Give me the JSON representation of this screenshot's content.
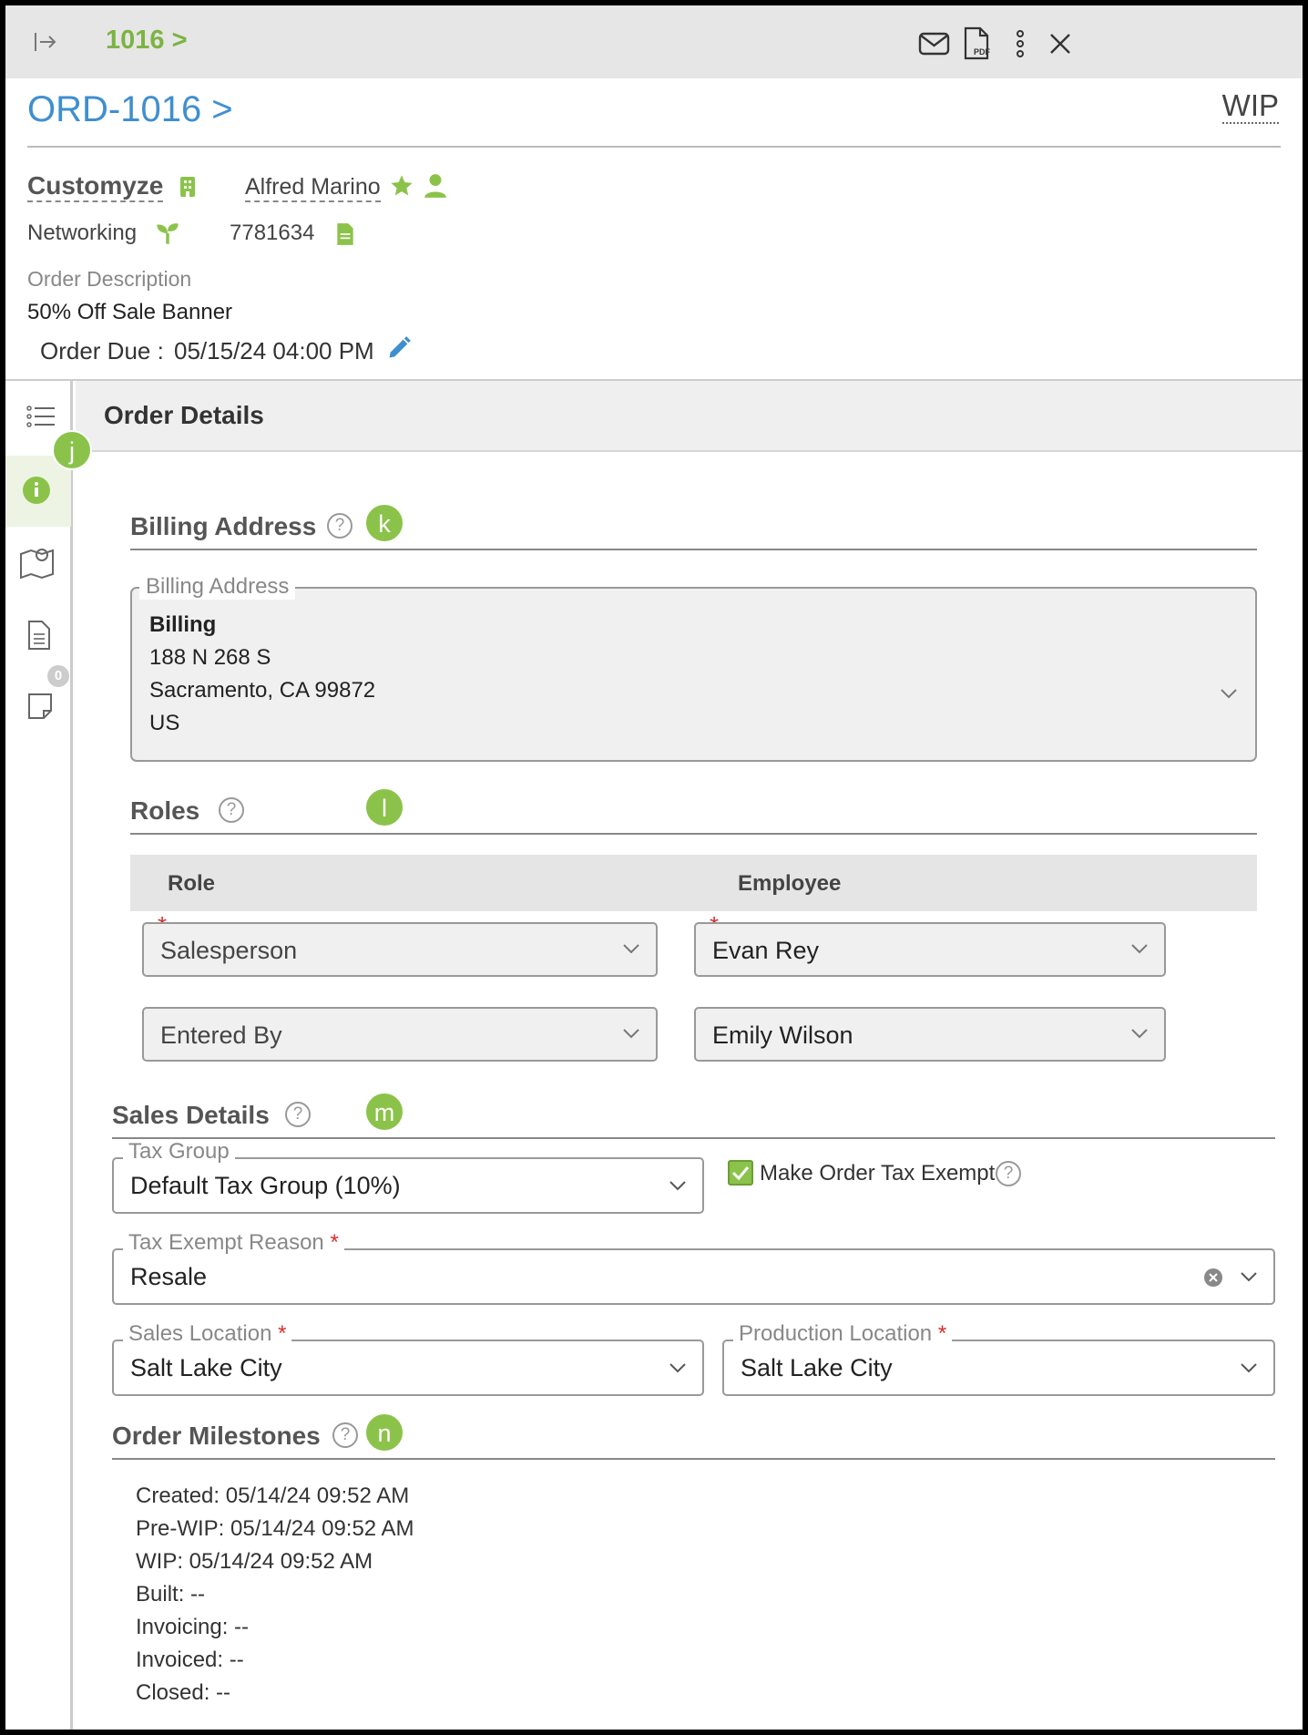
{
  "topbar": {
    "order_number": "1016 >"
  },
  "header": {
    "order_title": "ORD-1016 >",
    "status": "WIP",
    "company": "Customyze",
    "contact": "Alfred Marino",
    "industry": "Networking",
    "po_number": "7781634",
    "description_label": "Order Description",
    "description": "50% Off Sale Banner",
    "due_label": "Order Due :",
    "due_value": "05/15/24 04:00 PM"
  },
  "rail": {
    "notes_count": "0"
  },
  "section": {
    "title": "Order Details"
  },
  "badges": {
    "j": "j",
    "k": "k",
    "l": "l",
    "m": "m",
    "n": "n"
  },
  "billing": {
    "heading": "Billing Address",
    "field_label": "Billing Address",
    "name": "Billing",
    "street": "188 N 268 S",
    "city": "Sacramento, CA 99872",
    "country": "US"
  },
  "roles": {
    "heading": "Roles",
    "col_role": "Role",
    "col_employee": "Employee",
    "rows": [
      {
        "role": "Salesperson",
        "employee": "Evan Rey"
      },
      {
        "role": "Entered By",
        "employee": "Emily Wilson"
      }
    ]
  },
  "sales": {
    "heading": "Sales Details",
    "tax_group_label": "Tax Group",
    "tax_group": "Default Tax Group (10%)",
    "tax_exempt_label": "Make Order Tax Exempt",
    "tax_exempt_checked": true,
    "exempt_reason_label": "Tax Exempt Reason",
    "exempt_reason": "Resale",
    "sales_location_label": "Sales Location",
    "sales_location": "Salt Lake City",
    "production_location_label": "Production Location",
    "production_location": "Salt Lake City",
    "required_mark": "*"
  },
  "milestones": {
    "heading": "Order Milestones",
    "items": [
      "Created:  05/14/24 09:52 AM",
      "Pre-WIP:  05/14/24 09:52 AM",
      "WIP:  05/14/24 09:52 AM",
      "Built:  --",
      "Invoicing:  --",
      "Invoiced:  --",
      "Closed:  --"
    ]
  },
  "colors": {
    "accent": "#8bc34a",
    "link": "#3f8fd0",
    "required": "#d32f2f"
  }
}
